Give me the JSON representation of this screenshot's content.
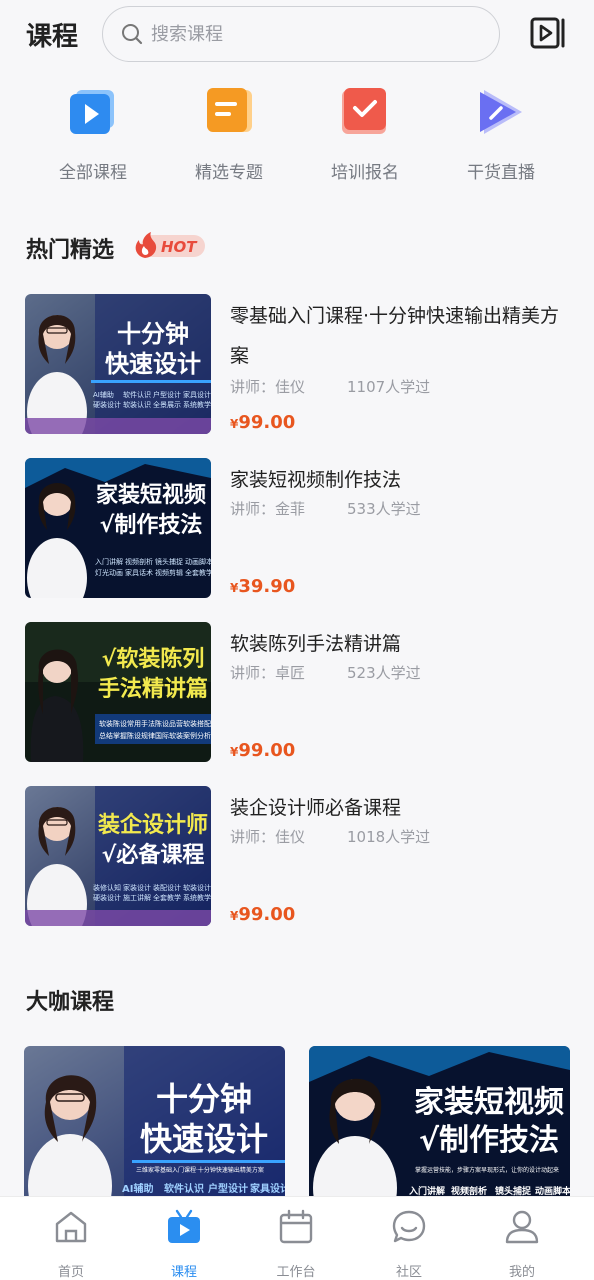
{
  "header": {
    "title": "课程",
    "search_placeholder": "搜索课程"
  },
  "categories": [
    {
      "label": "全部课程",
      "icon": "play-square-icon",
      "color": "#2e8bf0"
    },
    {
      "label": "精选专题",
      "icon": "document-icon",
      "color": "#f59a23"
    },
    {
      "label": "培训报名",
      "icon": "check-square-icon",
      "color": "#ef5a4b"
    },
    {
      "label": "干货直播",
      "icon": "live-play-icon",
      "color": "#6a6ff2"
    }
  ],
  "hot_section": {
    "title": "热门精选",
    "badge": "HOT"
  },
  "courses": [
    {
      "title": "零基础入门课程·十分钟快速输出精美方案",
      "teacher": "讲师：佳仪",
      "learners": "1107人学过",
      "price": "99.00",
      "currency": "¥",
      "thumb": {
        "line1": "十分钟",
        "line2": "快速设计",
        "tags": [
          "AI辅助",
          "软件认识",
          "户型设计",
          "家具设计",
          "硬装设计",
          "软装认识",
          "全景展示",
          "系统教学"
        ]
      }
    },
    {
      "title": "家装短视频制作技法",
      "teacher": "讲师：金菲",
      "learners": "533人学过",
      "price": "39.90",
      "currency": "¥",
      "thumb": {
        "line1": "家装短视频",
        "line2": "√制作技法",
        "tags": [
          "入门讲解",
          "视频剖析",
          "镜头捕捉",
          "动画脚本",
          "灯光动画",
          "家具话术",
          "视频剪辑",
          "全套教学"
        ]
      }
    },
    {
      "title": "软装陈列手法精讲篇",
      "teacher": "讲师：卓匠",
      "learners": "523人学过",
      "price": "99.00",
      "currency": "¥",
      "thumb": {
        "line1": "√软装陈列",
        "line2": "手法精讲篇",
        "tags": [
          "软装陈设常用手法",
          "陈设品营软装搭配",
          "总结掌握陈设规律",
          "国际软装案例分析"
        ]
      }
    },
    {
      "title": "装企设计师必备课程",
      "teacher": "讲师：佳仪",
      "learners": "1018人学过",
      "price": "99.00",
      "currency": "¥",
      "thumb": {
        "line1": "装企设计师",
        "line2": "√必备课程",
        "tags": [
          "装修认知",
          "家装设计",
          "装配设计",
          "软装设计",
          "硬装设计",
          "施工讲解",
          "全套教学",
          "系统教学"
        ]
      }
    }
  ],
  "master_section": {
    "title": "大咖课程"
  },
  "master_cards": [
    {
      "line1": "十分钟",
      "line2": "快速设计",
      "sub": "三维家零基础入门课程·十分钟快速输出精美方案",
      "tags": [
        "AI辅助",
        "软件认识",
        "户型设计",
        "家具设计"
      ]
    },
    {
      "line1": "家装短视频",
      "line2": "√制作技法",
      "sub": "掌握运营技能，步骤方案早现形式，让你的设计动起来",
      "tags": [
        "入门讲解",
        "视频剖析",
        "镜头捕捉",
        "动画脚本"
      ]
    }
  ],
  "tabbar": [
    {
      "label": "首页",
      "icon": "home-icon",
      "active": false
    },
    {
      "label": "课程",
      "icon": "course-tv-icon",
      "active": true
    },
    {
      "label": "工作台",
      "icon": "calendar-icon",
      "active": false
    },
    {
      "label": "社区",
      "icon": "chat-bubble-icon",
      "active": false
    },
    {
      "label": "我的",
      "icon": "user-icon",
      "active": false
    }
  ],
  "colors": {
    "accent": "#2b8ef0",
    "price": "#e8561f",
    "hot": "#e84b3c"
  }
}
